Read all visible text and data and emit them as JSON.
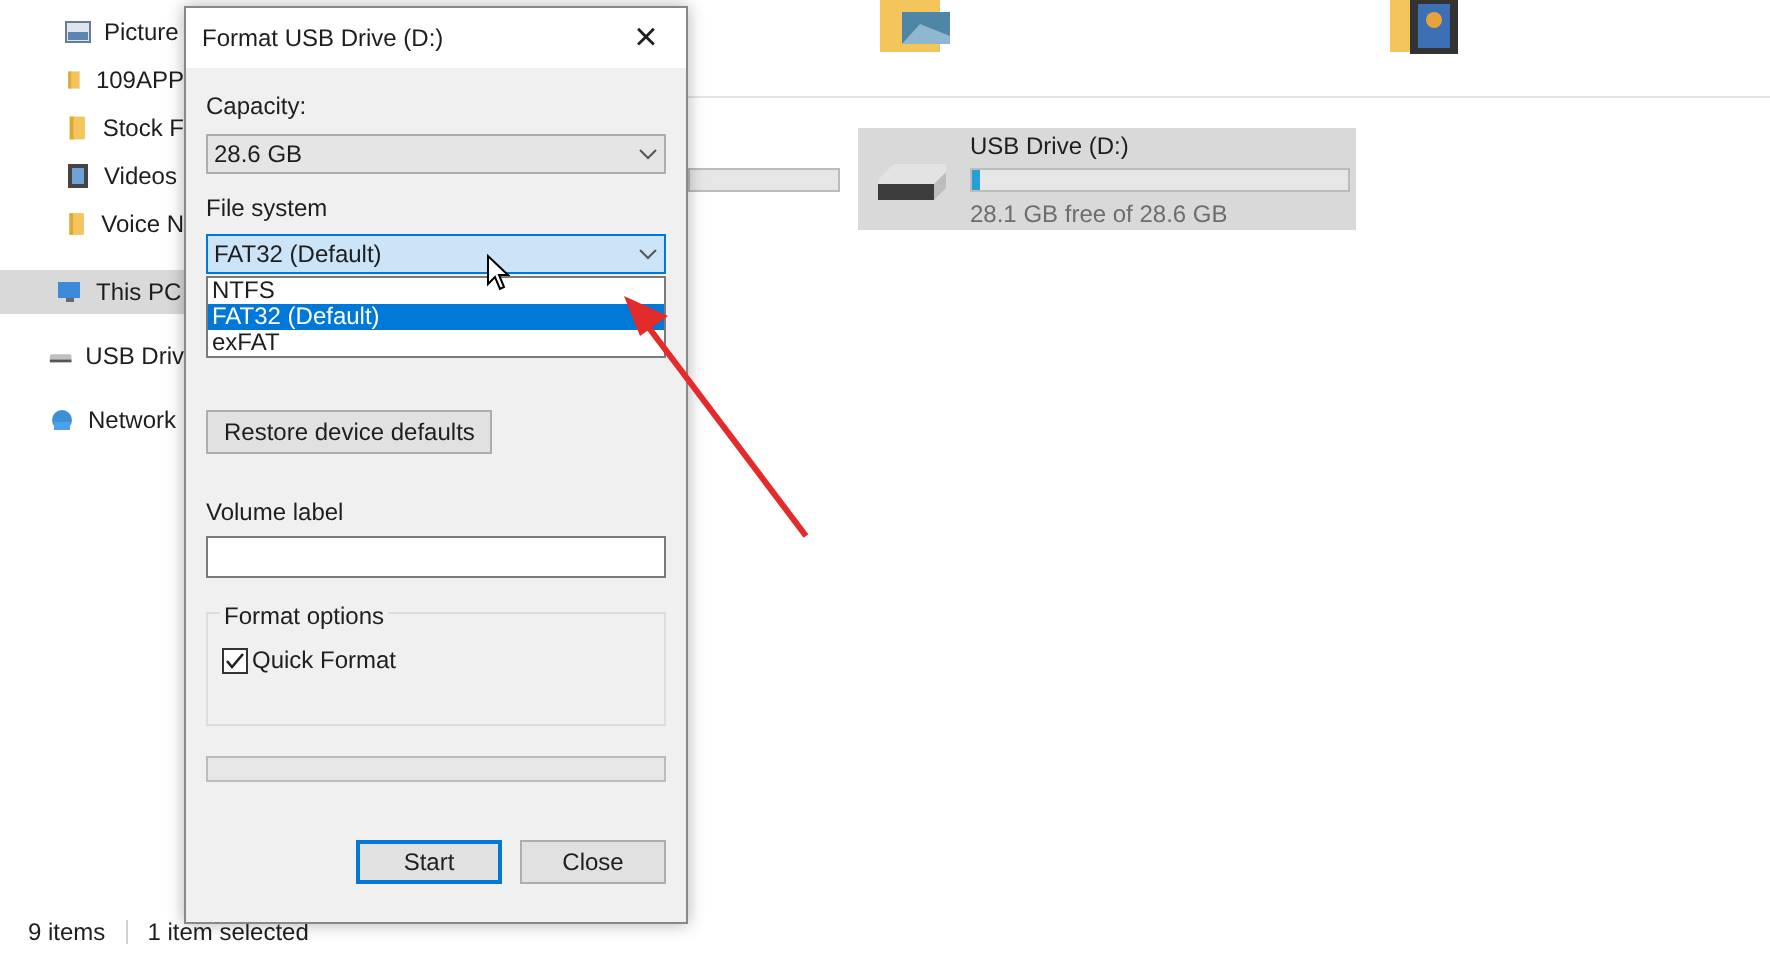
{
  "sidebar": {
    "items": [
      {
        "label": "Picture",
        "kind": "pictures",
        "selected": false
      },
      {
        "label": "109APP",
        "kind": "folder",
        "selected": false
      },
      {
        "label": "Stock F",
        "kind": "folder",
        "selected": false
      },
      {
        "label": "Videos",
        "kind": "videos",
        "selected": false
      },
      {
        "label": "Voice N",
        "kind": "folder",
        "selected": false
      },
      {
        "label": "This PC",
        "kind": "pc",
        "selected": true
      },
      {
        "label": "USB Driv",
        "kind": "drive",
        "selected": false
      },
      {
        "label": "Network",
        "kind": "network",
        "selected": false
      }
    ]
  },
  "drive": {
    "name": "USB Drive (D:)",
    "level": 0.02,
    "free_text": "28.1 GB free of 28.6 GB",
    "selected": true
  },
  "status_bar": {
    "items_count": "9 items",
    "selection": "1 item selected"
  },
  "dialog": {
    "title": "Format USB Drive (D:)",
    "close": "×",
    "capacity": {
      "label": "Capacity:",
      "value": "28.6 GB"
    },
    "file_system": {
      "label": "File system",
      "value": "FAT32 (Default)",
      "expanded": true,
      "options": [
        {
          "label": "NTFS",
          "selected": false
        },
        {
          "label": "FAT32 (Default)",
          "selected": true
        },
        {
          "label": "exFAT",
          "selected": false
        }
      ]
    },
    "restore_button": "Restore device defaults",
    "volume_label": {
      "label": "Volume label"
    },
    "format_options": {
      "title": "Format options",
      "quick_format": {
        "label": "Quick Format",
        "checked": true
      }
    },
    "progress": {
      "level": 0
    },
    "buttons": [
      {
        "label": "Start",
        "default": true
      },
      {
        "label": "Close",
        "default": false
      }
    ]
  }
}
